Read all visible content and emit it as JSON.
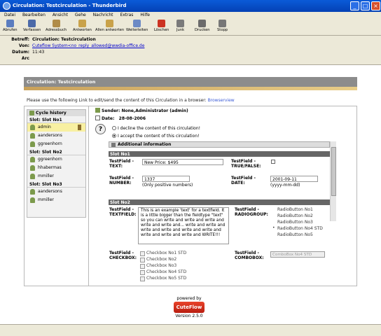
{
  "window": {
    "title": "Circulation: Testcirculation - Thunderbird"
  },
  "menu": [
    "Datei",
    "Bearbeiten",
    "Ansicht",
    "Gehe",
    "Nachricht",
    "Extras",
    "Hilfe"
  ],
  "toolbar": [
    {
      "label": "Abrufen",
      "icon": "get-mail-icon",
      "color": "#5b7dbf"
    },
    {
      "label": "Verfassen",
      "icon": "compose-icon",
      "color": "#4c6aa8"
    },
    {
      "label": "Adressbuch",
      "icon": "address-book-icon",
      "color": "#b08c48"
    },
    {
      "label": "Antworten",
      "icon": "reply-icon",
      "color": "#c9a24a"
    },
    {
      "label": "Allen antworten",
      "icon": "reply-all-icon",
      "color": "#c9a24a"
    },
    {
      "label": "Weiterleiten",
      "icon": "forward-icon",
      "color": "#6c8ac5"
    },
    {
      "label": "Löschen",
      "icon": "delete-icon",
      "color": "#cc3322"
    },
    {
      "label": "Junk",
      "icon": "junk-icon",
      "color": "#7a7a7a"
    },
    {
      "label": "Drucken",
      "icon": "print-icon",
      "color": "#6b6b6b"
    },
    {
      "label": "Stopp",
      "icon": "stop-icon",
      "color": "#777777"
    }
  ],
  "headers": {
    "subject_label": "Betreff:",
    "subject": "Circulation: Testcirculation",
    "from_label": "Von:",
    "from": "Cuteflow System<no_reply_allowed@wwdia-office.de",
    "date_label": "Datum:",
    "date": "11:43",
    "arc_label": "Arc"
  },
  "circulation": {
    "title": "Circulation: Testcirculation",
    "link_text": "Please use the following Link to edit/send the content of this Circulation in a browser:",
    "link_label": "Browserview",
    "history_title": "Cycle history",
    "slots": [
      {
        "name": "Slot: Slot No1",
        "users": [
          "admin",
          "aandersons",
          "ggreenhorn"
        ]
      },
      {
        "name": "Slot: Slot No2",
        "users": [
          "ggreenhorn",
          "hhabermas",
          "mmiller"
        ]
      },
      {
        "name": "Slot: Slot No3",
        "users": [
          "aandersons",
          "mmiller"
        ]
      }
    ],
    "sender": "Sender: None,Administrator (admin)",
    "date_label": "Date:",
    "date_value": "28-08-2006",
    "decline": "I decline the content of this circulation!",
    "accept": "I accept the content of this circulation!",
    "additional_info": "Additional information",
    "slot1": "Slot No1",
    "slot2": "Slot No2",
    "text_label": "TestField - TEXT:",
    "text_value": "New Price: $495",
    "truefalse_label": "TestField - TRUE/FALSE:",
    "number_label": "TestField - NUMBER:",
    "number_value": "1337",
    "number_hint": "(Only positive numbers)",
    "date_field_label": "TestField - DATE:",
    "date_field_value": "2001-09-11",
    "date_hint": "(yyyy-mm-dd)",
    "textfield_label": "TestField - TEXTFIELD:",
    "textfield_value": "This is an example 'text' for a textfield. It is a little bigger than the fieldtype \"text\" so you can write and write and write and write and write and... write and write and write and write and write and write and write and write and write and WRITE!!!",
    "radiogroup_label": "TestField - RADIOGROUP:",
    "radio_options": [
      "RadioButton No1",
      "RadioButton No2",
      "RadioButton No3",
      "RadioButton No4 STD",
      "RadioButton No5"
    ],
    "checkbox_label": "TestField - CHECKBOX:",
    "checkbox_options": [
      "Checkbox No1 STD",
      "Checkbox No2",
      "Checkbox No3",
      "Checkbox No4 STD",
      "Checkbox No5 STD"
    ],
    "combobox_label": "TestField - COMBOBOX:",
    "combobox_value": "ComboBox No4 STD"
  },
  "footer": {
    "powered_by": "powered by",
    "logo": "CuteFlow",
    "version": "Version 2.5.0"
  }
}
